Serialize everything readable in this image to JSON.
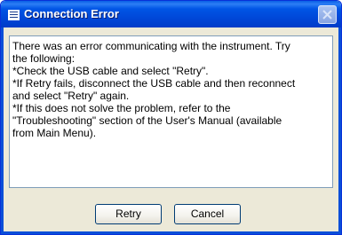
{
  "window": {
    "title": "Connection Error"
  },
  "message": {
    "lines": [
      "There was an error communicating with the instrument. Try",
      "the following:",
      "*Check the USB cable and select \"Retry\".",
      "*If Retry fails, disconnect the USB cable and then reconnect",
      "and select \"Retry\" again.",
      "*If this does not solve the problem, refer to the",
      "\"Troubleshooting\" section of the User's Manual (available",
      "from Main Menu)."
    ]
  },
  "buttons": {
    "retry_label": "Retry",
    "cancel_label": "Cancel"
  },
  "colors": {
    "titlebar": "#0055e5",
    "dialog_background": "#ece9d8",
    "close_button": "#9fb6e6"
  },
  "icons": {
    "title": "window-menu-icon",
    "close": "close-icon"
  }
}
